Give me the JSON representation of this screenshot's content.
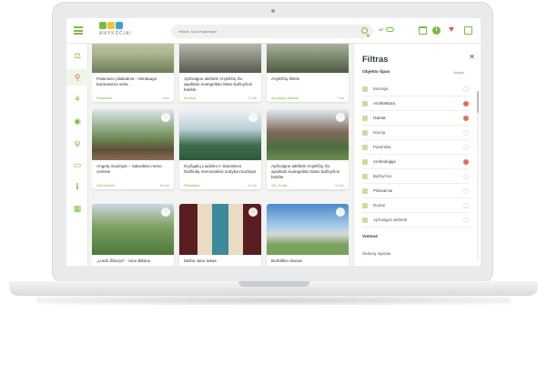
{
  "header": {
    "logo_text": "ANYKŠČIAI",
    "search_placeholder": "Ieškok, ką nori pamatyti",
    "weather_temp": "24°"
  },
  "sidebar": {
    "items": [
      {
        "icon": "balance-icon"
      },
      {
        "icon": "map-pin-icon",
        "active": true
      },
      {
        "icon": "bicycle-icon"
      },
      {
        "icon": "eye-icon"
      },
      {
        "icon": "fork-knife-icon"
      },
      {
        "icon": "bed-icon"
      },
      {
        "icon": "info-icon"
      },
      {
        "icon": "calendar-icon"
      }
    ]
  },
  "cards": [
    {
      "title": "Palacavio piliakalnis – Mindaugo karūnavimo vieta",
      "category": "Piliakalniai",
      "distance": "4 km"
    },
    {
      "title": "Apžvalgos aikštelė Anykščių Šv. apaštalo evangelisto Mato bažnyčios bokšte",
      "category": "Muziejai",
      "distance": "17 km"
    },
    {
      "title": "Anykščių šilelis",
      "category": "Apžvalgos aikštelė",
      "distance": "7 km"
    },
    {
      "title": "Angelų muziejus – Sakralinio meno centras",
      "category": "Anti Nesterė",
      "distance": "60 km"
    },
    {
      "title": "Kryžgalių Liudviko ir Stanislovo Didžiulių memorialinė sodyba-muziejus",
      "category": "Piliakalniai",
      "distance": "21 km"
    },
    {
      "title": "Apžvalgos aikštelė Anykščių Šv. apaštalo evangelisto Mato bažnyčios bokšte",
      "category": "Sav. Sodai",
      "distance": "21 km"
    },
    {
      "title": "„Lurdo Žiburys“ - Iono Biliūno",
      "category": "",
      "distance": ""
    },
    {
      "title": "Mažiu Janu takas",
      "category": "",
      "distance": ""
    },
    {
      "title": "Burbiškio dvaras",
      "category": "",
      "distance": ""
    }
  ],
  "filter": {
    "title": "Filtras",
    "section_title": "Objekto tipas",
    "clear_label": "Išvalyti",
    "items": [
      {
        "label": "Muziejai",
        "selected": false
      },
      {
        "label": "Architektūra",
        "selected": true
      },
      {
        "label": "Gamta",
        "selected": true
      },
      {
        "label": "Istorija",
        "selected": false
      },
      {
        "label": "Paminklai",
        "selected": false
      },
      {
        "label": "Archeologija",
        "selected": true
      },
      {
        "label": "Bažnyčios",
        "selected": false
      },
      {
        "label": "Piliakalniai",
        "selected": false
      },
      {
        "label": "Dvarai",
        "selected": false
      },
      {
        "label": "Apžvalgos aikštelė",
        "selected": false
      }
    ],
    "second_section_title": "Vietovė",
    "location_placeholder": "Šeduvų rajonas"
  },
  "colors": {
    "accent": "#7cbb3f",
    "selected": "#e46c5a",
    "text_dark": "#2c3e43"
  }
}
